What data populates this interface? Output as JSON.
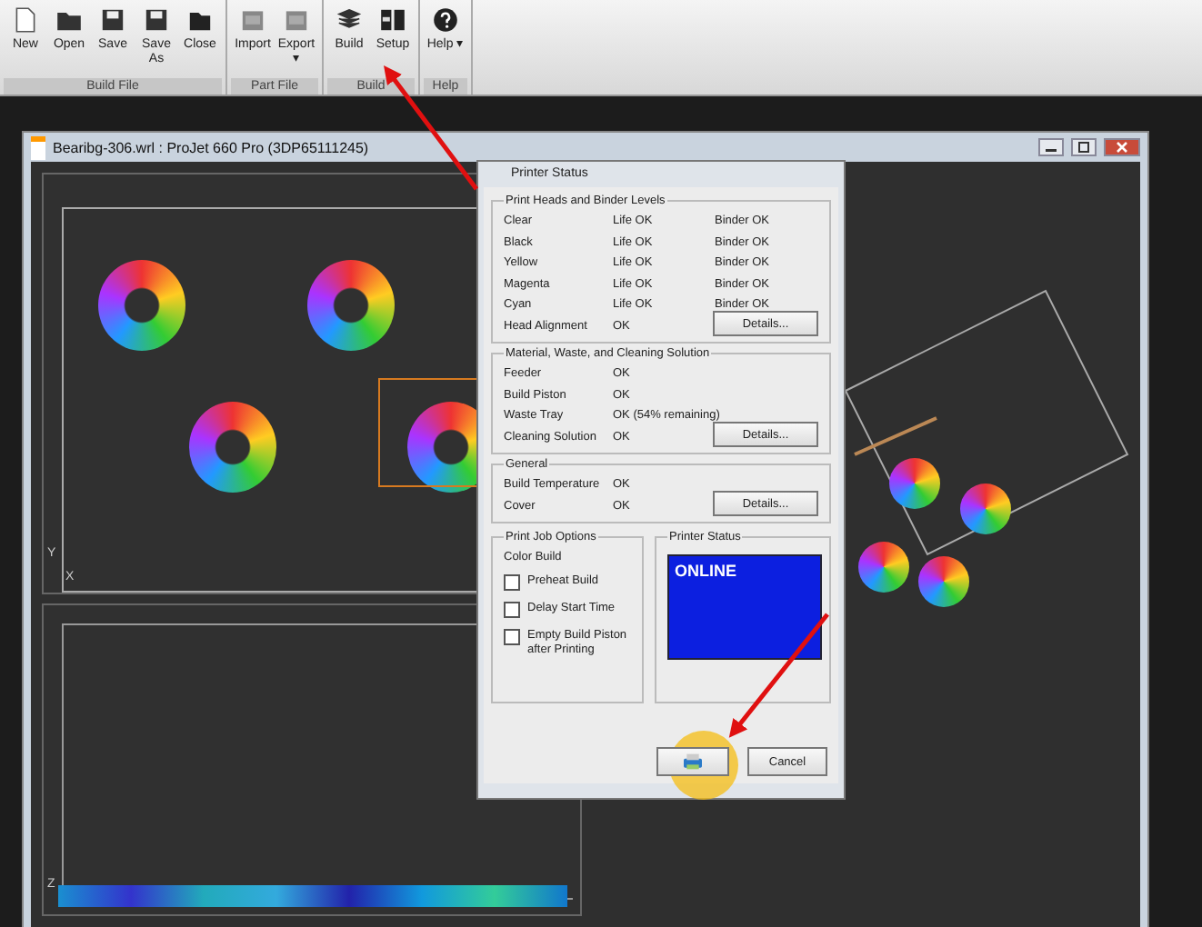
{
  "ribbon": {
    "groups": [
      {
        "label": "Build File",
        "buttons": [
          {
            "label": "New",
            "kind": "new"
          },
          {
            "label": "Open",
            "kind": "open"
          },
          {
            "label": "Save",
            "kind": "save"
          },
          {
            "label": "Save As",
            "kind": "save"
          },
          {
            "label": "Close",
            "kind": "close"
          }
        ]
      },
      {
        "label": "Part File",
        "buttons": [
          {
            "label": "Import",
            "kind": "import"
          },
          {
            "label": "Export ▾",
            "kind": "export"
          }
        ]
      },
      {
        "label": "Build",
        "buttons": [
          {
            "label": "Build",
            "kind": "build"
          },
          {
            "label": "Setup",
            "kind": "setup"
          }
        ]
      },
      {
        "label": "Help",
        "buttons": [
          {
            "label": "Help ▾",
            "kind": "help"
          }
        ]
      }
    ]
  },
  "window": {
    "title": "Bearibg-306.wrl : ProJet 660 Pro (3DP65111245)",
    "axis_labels": [
      {
        "text": "Y"
      },
      {
        "text": "X"
      },
      {
        "text": "Z"
      }
    ]
  },
  "dialog": {
    "title": "Printer Status",
    "sections": [
      {
        "title": "Print Heads and Binder Levels",
        "rows": [
          {
            "label": "Clear",
            "value": "Life OK",
            "value_2": "Binder OK"
          },
          {
            "label": "Black",
            "value": "Life OK",
            "value_2": "Binder OK"
          },
          {
            "label": "Yellow",
            "value": "Life OK",
            "value_2": "Binder OK"
          },
          {
            "label": "Magenta",
            "value": "Life OK",
            "value_2": "Binder OK"
          },
          {
            "label": "Cyan",
            "value": "Life OK",
            "value_2": "Binder OK"
          },
          {
            "label": "Head Alignment",
            "value": "OK"
          }
        ],
        "button": "Details..."
      },
      {
        "title": "Material, Waste, and Cleaning Solution",
        "rows": [
          {
            "label": "Feeder",
            "value": "OK"
          },
          {
            "label": "Build Piston",
            "value": "OK"
          },
          {
            "label": "Waste Tray",
            "value": "OK  (54% remaining)"
          },
          {
            "label": "Cleaning Solution",
            "value": "OK"
          }
        ],
        "button": "Details..."
      },
      {
        "title": "General",
        "rows": [
          {
            "label": "Build Temperature",
            "value": "OK"
          },
          {
            "label": "Cover",
            "value": "OK"
          }
        ],
        "button": "Details..."
      }
    ],
    "job_options": {
      "title": "Print Job Options",
      "subtitle": "Color Build",
      "checkboxes": [
        {
          "label": "Preheat Build",
          "checked": false
        },
        {
          "label": "Delay Start Time",
          "checked": false
        },
        {
          "label": "Empty Build Piston after Printing",
          "checked": false
        }
      ]
    },
    "printer_status": {
      "title": "Printer Status",
      "status": "ONLINE"
    },
    "cancel_button": "Cancel"
  }
}
